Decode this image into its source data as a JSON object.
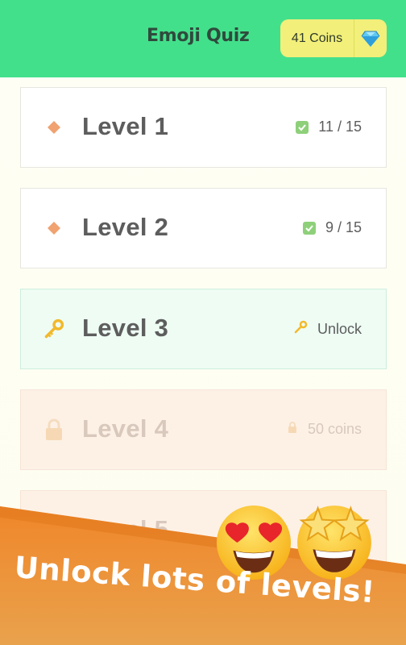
{
  "header": {
    "title": "Emoji Quiz",
    "coins_label": "41 Coins",
    "gem_icon": "gem-icon"
  },
  "levels": [
    {
      "name": "Level 1",
      "status": "11 / 15",
      "state": "completed"
    },
    {
      "name": "Level 2",
      "status": "9 / 15",
      "state": "completed"
    },
    {
      "name": "Level 3",
      "status": "Unlock",
      "state": "unlockable"
    },
    {
      "name": "Level 4",
      "status": "50 coins",
      "state": "locked"
    },
    {
      "name": "Level 5",
      "status": "",
      "state": "locked"
    }
  ],
  "banner": {
    "text": "Unlock lots of levels!"
  },
  "colors": {
    "header": "#43e08c",
    "coins_pill": "#f2ef7a",
    "banner_orange": "#f08a24"
  }
}
